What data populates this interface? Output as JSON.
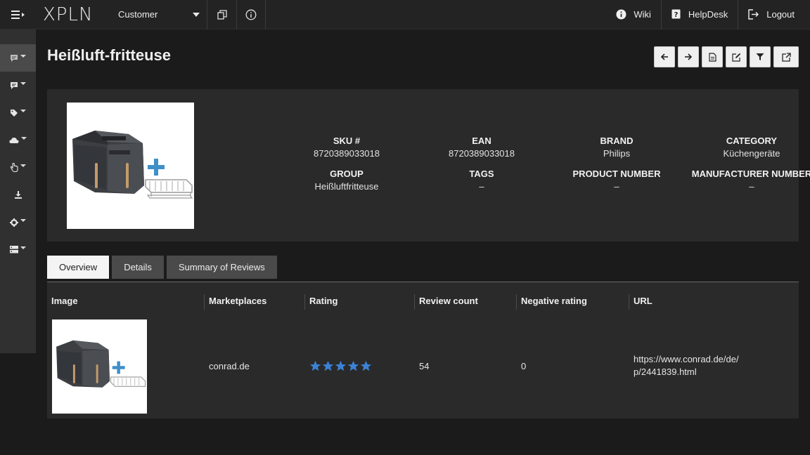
{
  "header": {
    "logo": "XPLN",
    "customer_select": "Customer",
    "links": [
      {
        "label": "Wiki",
        "icon": "info-circle-icon"
      },
      {
        "label": "HelpDesk",
        "icon": "helpdesk-icon"
      },
      {
        "label": "Logout",
        "icon": "logout-icon"
      }
    ]
  },
  "page": {
    "title": "Heißluft-fritteuse"
  },
  "product_info": {
    "sku_label": "SKU #",
    "sku_value": "8720389033018",
    "ean_label": "EAN",
    "ean_value": "8720389033018",
    "brand_label": "BRAND",
    "brand_value": "Philips",
    "category_label": "CATEGORY",
    "category_value": "Küchengeräte",
    "group_label": "GROUP",
    "group_value": "Heißluftfritteuse",
    "tags_label": "TAGS",
    "tags_value": "–",
    "product_number_label": "PRODUCT NUMBER",
    "product_number_value": "–",
    "manufacturer_number_label": "MANUFACTURER NUMBER",
    "manufacturer_number_value": "–"
  },
  "tabs": [
    {
      "label": "Overview",
      "active": true
    },
    {
      "label": "Details",
      "active": false
    },
    {
      "label": "Summary of Reviews",
      "active": false
    }
  ],
  "table": {
    "columns": [
      "Image",
      "Marketplaces",
      "Rating",
      "Review count",
      "Negative rating",
      "URL"
    ],
    "rows": [
      {
        "marketplace": "conrad.de",
        "rating": 5,
        "rating_max": 5,
        "review_count": "54",
        "negative_rating": "0",
        "url_line1": "https://www.conrad.de/de/",
        "url_line2": "p/2441839.html"
      }
    ]
  },
  "colors": {
    "star": "#3b82d6",
    "accent": "#2f86c8"
  }
}
